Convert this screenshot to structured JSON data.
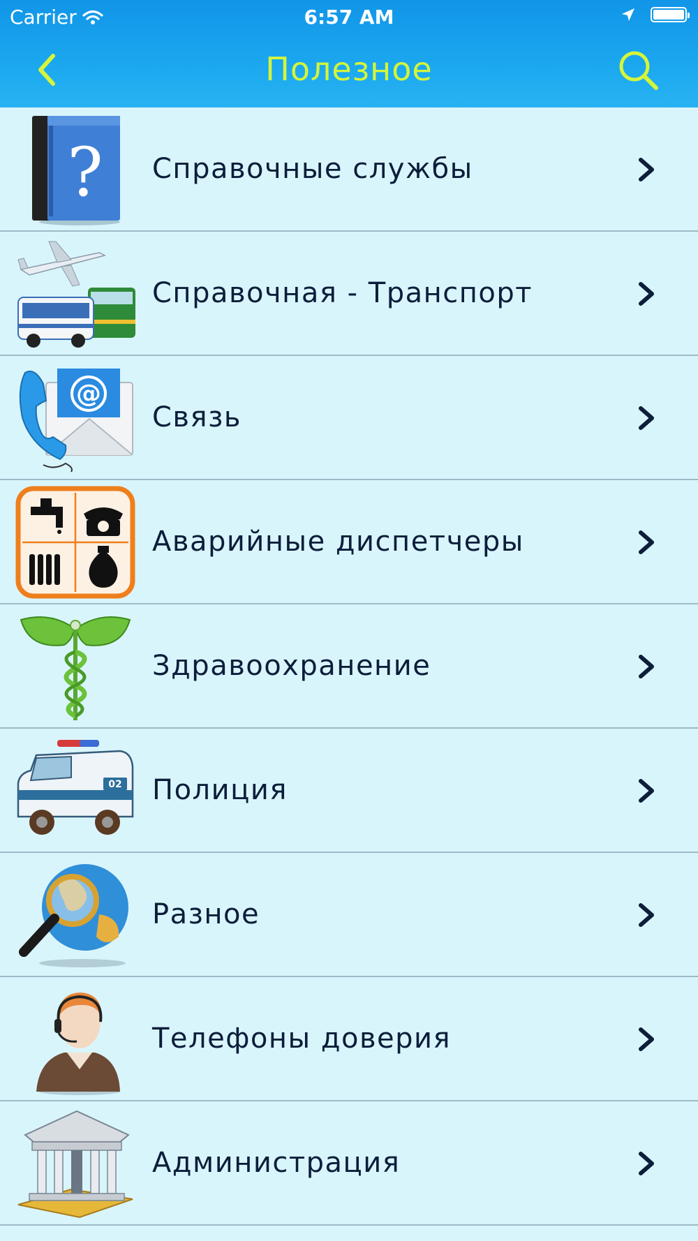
{
  "status_bar": {
    "carrier": "Carrier",
    "time": "6:57 AM"
  },
  "navbar": {
    "title": "Полезное",
    "title_color": "#d4f53b",
    "back_icon": "chevron-left-icon",
    "search_icon": "search-icon"
  },
  "colors": {
    "bar_gradient_top": "#1195e8",
    "list_background": "#d9f5fc",
    "label_text": "#0c1e3a",
    "separator": "#9fb9c6"
  },
  "items": [
    {
      "label": "Справочные службы",
      "icon": "help-book-icon"
    },
    {
      "label": "Справочная - Транспорт",
      "icon": "transport-icon"
    },
    {
      "label": "Связь",
      "icon": "phone-mail-icon"
    },
    {
      "label": "Аварийные диспетчеры",
      "icon": "utilities-icon"
    },
    {
      "label": "Здравоохранение",
      "icon": "caduceus-icon"
    },
    {
      "label": "Полиция",
      "icon": "police-car-icon"
    },
    {
      "label": "Разное",
      "icon": "globe-magnifier-icon"
    },
    {
      "label": "Телефоны доверия",
      "icon": "operator-icon"
    },
    {
      "label": "Администрация",
      "icon": "government-building-icon"
    }
  ]
}
